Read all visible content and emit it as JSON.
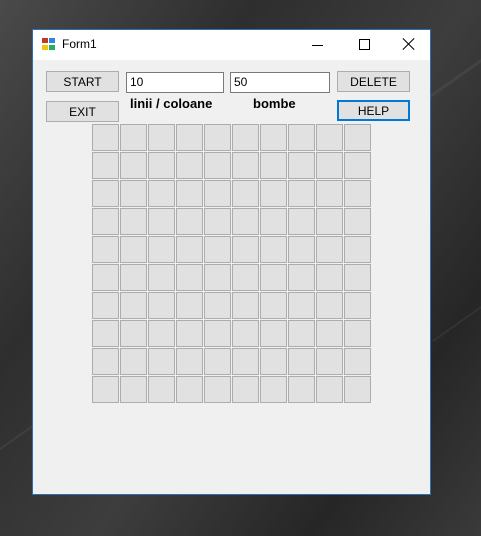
{
  "window": {
    "title": "Form1"
  },
  "toolbar": {
    "start_label": "START",
    "exit_label": "EXIT",
    "delete_label": "DELETE",
    "help_label": "HELP"
  },
  "inputs": {
    "rows_cols_value": "10",
    "bombs_value": "50"
  },
  "labels": {
    "rows_cols": "linii / coloane",
    "bombs": "bombe"
  },
  "board": {
    "rows": 10,
    "columns": 10
  },
  "colors": {
    "window_border": "#2b6fb4",
    "form_background": "#f0f0f0",
    "button_background": "#e1e1e1",
    "focus_border": "#0078d7"
  }
}
